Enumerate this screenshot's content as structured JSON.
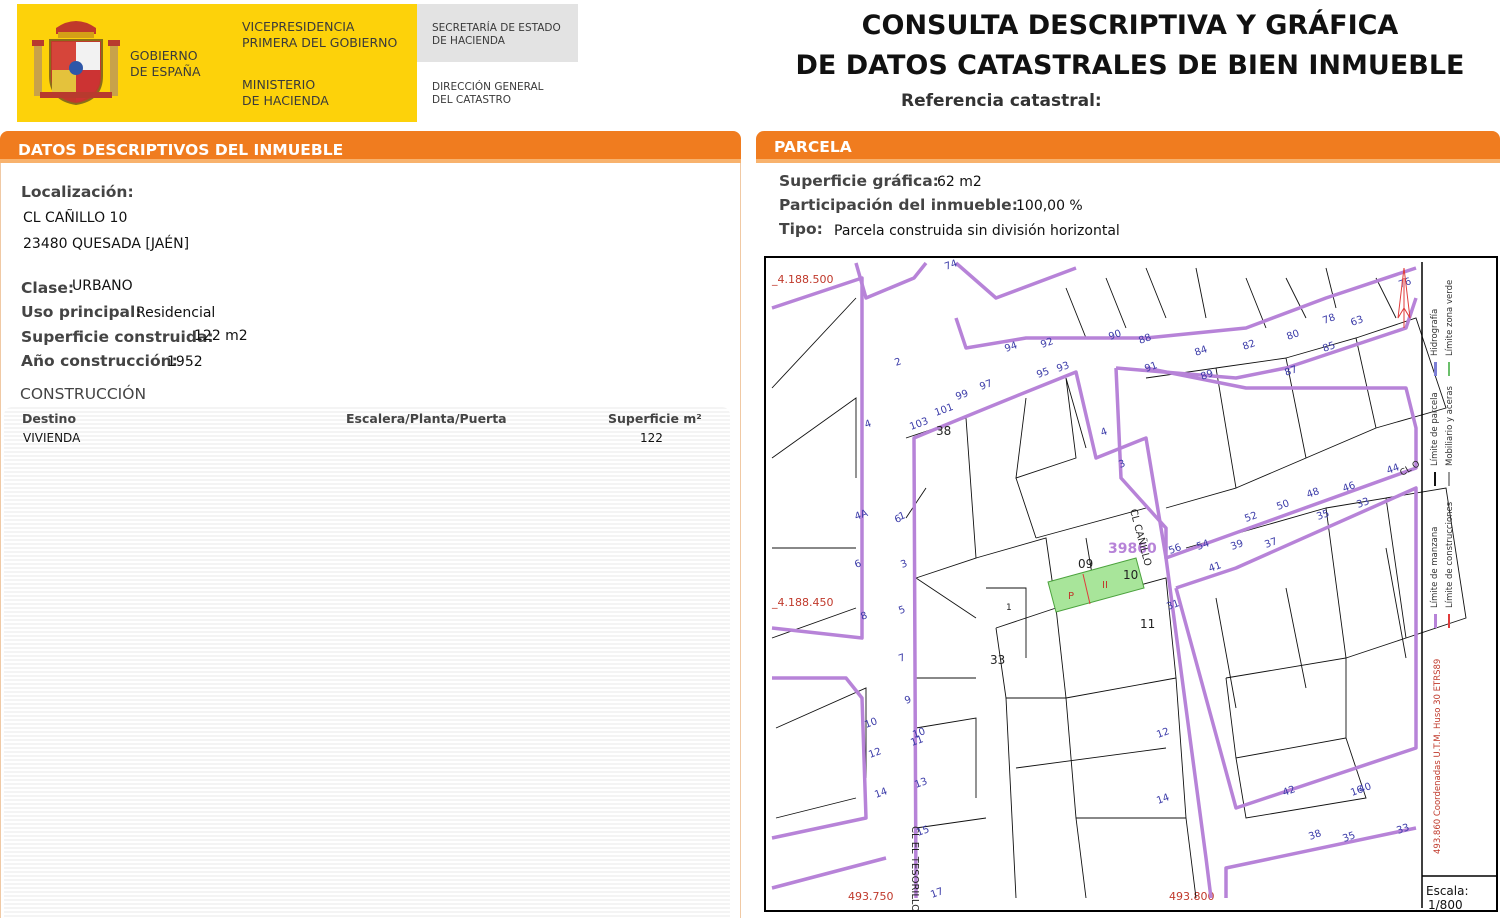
{
  "header": {
    "gov_name": "GOBIERNO\nDE ESPAÑA",
    "vice": "VICEPRESIDENCIA\nPRIMERA DEL GOBIERNO",
    "ministry": "MINISTERIO\nDE HACIENDA",
    "secretaria": "SECRETARÍA DE ESTADO\nDE HACIENDA",
    "direccion": "DIRECCIÓN GENERAL\nDEL CATASTRO",
    "title": "CONSULTA DESCRIPTIVA Y GRÁFICA\nDE DATOS CATASTRALES DE BIEN INMUEBLE",
    "ref_label": "Referencia catastral:"
  },
  "datos": {
    "section_title": "DATOS DESCRIPTIVOS DEL INMUEBLE",
    "localizacion_label": "Localización:",
    "address_line1": "CL CAÑILLO 10",
    "address_line2": "23480 QUESADA [JAÉN]",
    "clase_label": "Clase:",
    "clase_value": "URBANO",
    "uso_label": "Uso principal:",
    "uso_value": "Residencial",
    "sup_label": "Superficie construida:",
    "sup_value": "122 m2",
    "anio_label": "Año construcción:",
    "anio_value": "1952",
    "construccion_title": "CONSTRUCCIÓN",
    "table": {
      "headers": [
        "Destino",
        "Escalera/Planta/Puerta",
        "Superficie m²"
      ],
      "rows": [
        [
          "VIVIENDA",
          "",
          "122"
        ]
      ]
    }
  },
  "parcela": {
    "section_title": "PARCELA",
    "sup_label": "Superficie gráfica:",
    "sup_value": "62 m2",
    "part_label": "Participación del inmueble:",
    "part_value": "100,00 %",
    "tipo_label": "Tipo:",
    "tipo_value": "Parcela construida sin división horizontal"
  },
  "map": {
    "coord_y_top": "_4.188.500",
    "coord_y_mid": "_4.188.450",
    "coord_x_left": "493.750",
    "coord_x_mid": "493.800",
    "coord_side": "493.860 Coordenadas U.T.M. Huso 30 ETRS89",
    "legend": [
      "Límite de manzana",
      "Límite de construcciones",
      "Límite de parcela",
      "Mobiliario y aceras",
      "Hidrografía",
      "Límite zona verde"
    ],
    "scale_label": "Escala:",
    "scale_value": "1/800",
    "street1": "CL CAÑILLO",
    "street2": "CL EL TESORILLO",
    "street3": "CL O",
    "block_label": "39860",
    "parcel_p": "P",
    "parcel_ii": "II",
    "lot_numbers": [
      "09",
      "10",
      "11",
      "33",
      "38",
      "1"
    ],
    "street_numbers": [
      "76",
      "74",
      "2",
      "4",
      "94",
      "92",
      "90",
      "88",
      "84",
      "82",
      "80",
      "78",
      "63",
      "85",
      "87",
      "89",
      "91",
      "95",
      "93",
      "97",
      "99",
      "101",
      "103",
      "3",
      "4",
      "6",
      "44",
      "46",
      "48",
      "50",
      "52",
      "35",
      "33",
      "37",
      "39",
      "41",
      "54",
      "56",
      "1",
      "3",
      "5",
      "7",
      "9",
      "11",
      "13",
      "15",
      "4A",
      "6",
      "8",
      "10",
      "12",
      "14",
      "10",
      "12",
      "14",
      "16",
      "40",
      "42",
      "38",
      "35",
      "33",
      "31",
      "17"
    ]
  },
  "colors": {
    "orange": "#f07c1f",
    "yellow": "#fdd20a",
    "purple": "#b783d8",
    "parcel": "#a8e59a"
  }
}
